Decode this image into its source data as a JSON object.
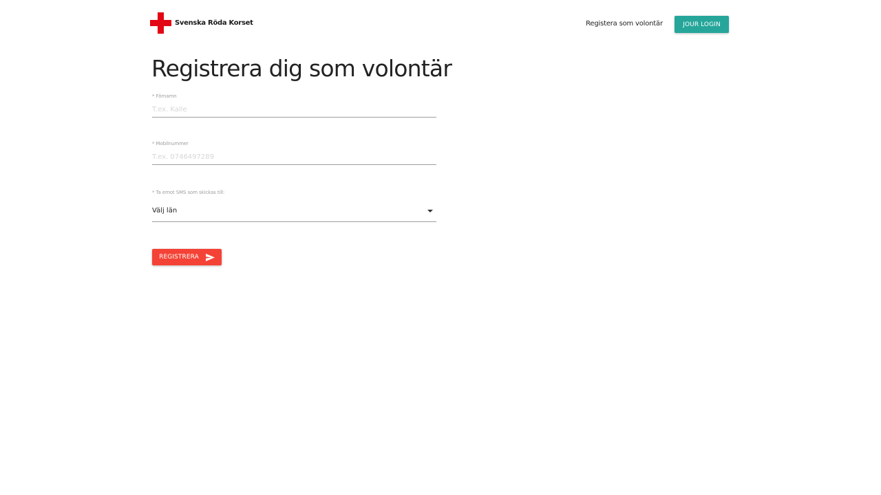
{
  "header": {
    "logo_text": "Svenska Röda Korset",
    "nav_link": "Registera som volontär",
    "login_button": "JOUR LOGIN"
  },
  "main": {
    "title": "Registrera dig som volontär",
    "fields": {
      "first_name": {
        "label": "* Förnamn",
        "placeholder": "T.ex. Kalle",
        "value": ""
      },
      "phone": {
        "label": "* Mobilnummer",
        "placeholder": "T.ex. 0746497289",
        "value": ""
      },
      "county": {
        "label": "* Ta emot SMS som skickas till:",
        "selected": "Välj län"
      }
    },
    "submit_button": "REGISTRERA"
  },
  "icons": {
    "logo": "red-cross-icon",
    "dropdown": "caret-down-icon",
    "submit": "send-icon"
  },
  "colors": {
    "brand_red": "#e30613",
    "teal": "#26a69a",
    "button_red": "#f44336"
  }
}
